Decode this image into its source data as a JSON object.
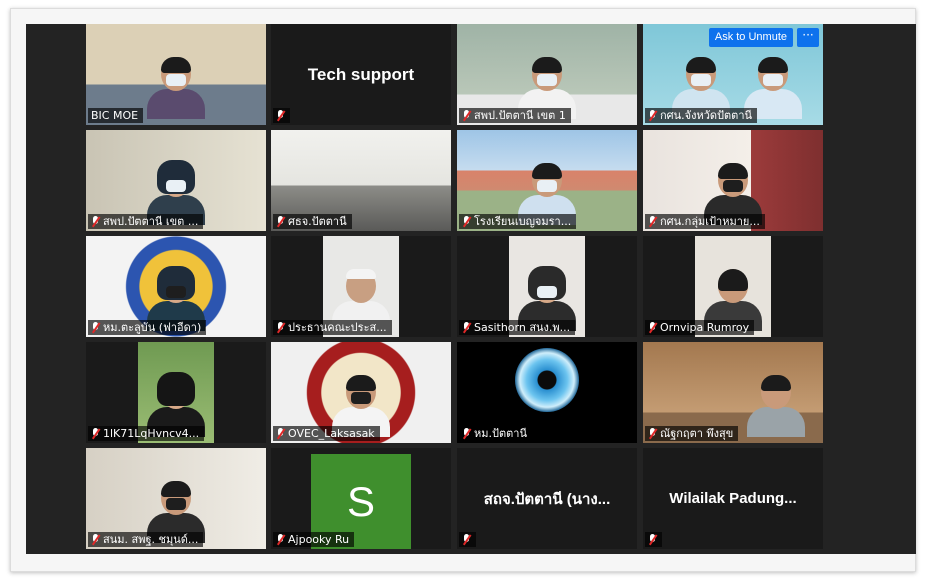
{
  "participants": [
    {
      "name": "BIC MOE",
      "display": "video",
      "active": true
    },
    {
      "name": "",
      "display": "name",
      "big": "Tech support"
    },
    {
      "name": "สพป.ปัตตานี เขต 1",
      "display": "video"
    },
    {
      "name": "กศน.จังหวัดปัตตานี",
      "display": "video"
    },
    {
      "name": "สพป.ปัตตานี เขต ...",
      "display": "video"
    },
    {
      "name": "ศธจ.ปัตตานี",
      "display": "video"
    },
    {
      "name": "โรงเรียนเบญจมรา...",
      "display": "video"
    },
    {
      "name": "กศน.กลุ่มเป้าหมาย...",
      "display": "video"
    },
    {
      "name": "หม.ตะลูบัน (ฟาอีดา)",
      "display": "video"
    },
    {
      "name": "ประธานคณะประส...",
      "display": "video"
    },
    {
      "name": "Sasithorn สนง.พ...",
      "display": "video"
    },
    {
      "name": "Ornvipa Rumroy",
      "display": "video"
    },
    {
      "name": "1lK71LqHvncv4...",
      "display": "video"
    },
    {
      "name": "OVEC_Laksasak",
      "display": "video"
    },
    {
      "name": "หม.ปัตตานี",
      "display": "video"
    },
    {
      "name": "ณัฐกฤตา พึงสุข",
      "display": "video"
    },
    {
      "name": "สนม. สพฐ. ชมุนด์...",
      "display": "video"
    },
    {
      "name": "Ajpooky Ru",
      "display": "avatar",
      "initial": "S"
    },
    {
      "name": "",
      "display": "name",
      "big": "สถจ.ปัตตานี (นาง..."
    },
    {
      "name": "",
      "display": "name",
      "big": "Wilailak  Padung..."
    }
  ],
  "controls": {
    "ask_unmute": "Ask to Unmute",
    "more": "···"
  },
  "colors": {
    "active_speaker": "#b8d846",
    "unmute_button": "#0e72ed",
    "muted_mic": "#e02828"
  }
}
